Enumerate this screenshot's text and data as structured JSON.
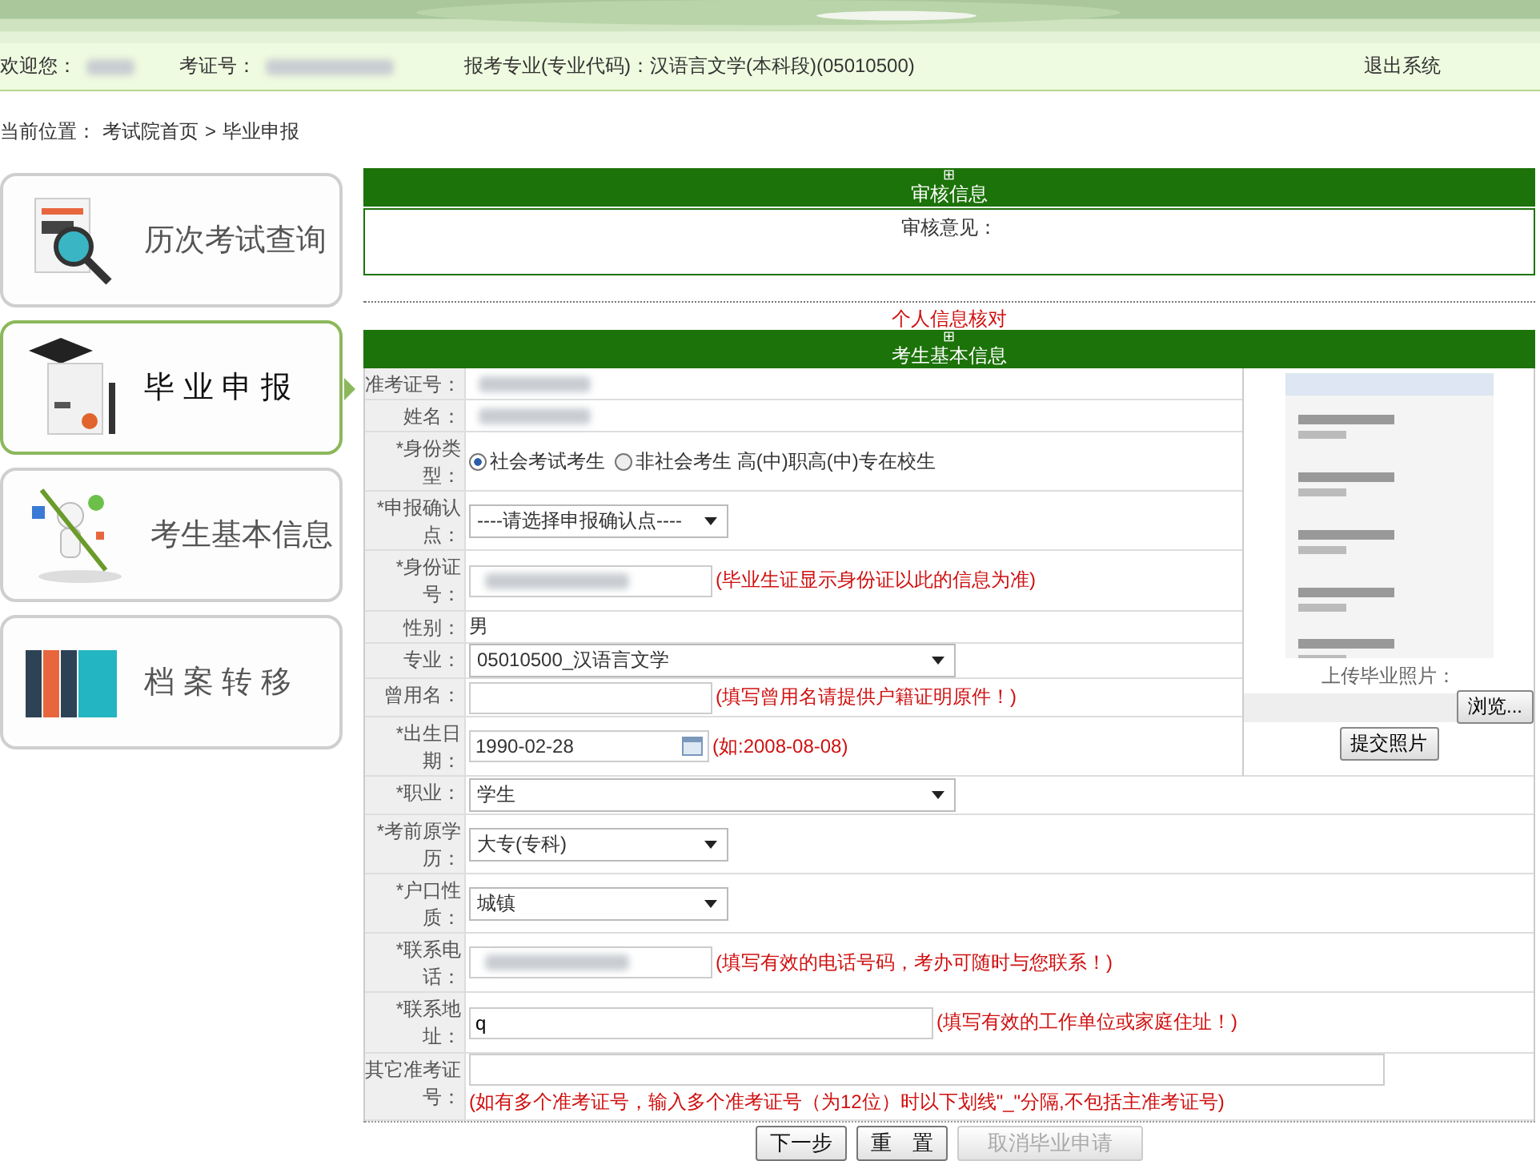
{
  "header": {
    "welcome_label": "欢迎您：",
    "exam_no_label": "考证号：",
    "major_label": "报考专业(专业代码)：汉语言文学(本科段)(05010500)",
    "logout": "退出系统"
  },
  "breadcrumb": {
    "prefix": "当前位置：",
    "home": "考试院首页",
    "separator": ">",
    "current": "毕业申报"
  },
  "sidebar": [
    {
      "label": "历次考试查询",
      "kind": "search",
      "selected": false
    },
    {
      "label": "毕 业 申 报",
      "kind": "diploma",
      "selected": true
    },
    {
      "label": "考生基本信息",
      "kind": "figure",
      "selected": false
    },
    {
      "label": "档 案 转 移",
      "kind": "folders",
      "selected": false
    }
  ],
  "audit": {
    "toggle": "⊞",
    "title": "审核信息",
    "opinion_label": "审核意见："
  },
  "section_title": "个人信息核对",
  "basic": {
    "toggle": "⊞",
    "title": "考生基本信息"
  },
  "photo": {
    "kind": "picture",
    "label": "上传毕业照片：",
    "browse": "浏览...",
    "submit": "提交照片"
  },
  "top_rows": [
    {
      "label": "准考证号：",
      "kind": "text",
      "redacted": true
    },
    {
      "label": "姓名：",
      "kind": "text",
      "redacted": true
    },
    {
      "label": "*身份类型：",
      "kind": "radio",
      "options": [
        {
          "label": "社会考试考生",
          "selected": true
        },
        {
          "label": "非社会考生 高(中)职高(中)专在校生",
          "selected": false
        }
      ]
    },
    {
      "label": "*申报确认点：",
      "kind": "select",
      "value": "----请选择申报确认点----"
    },
    {
      "label": "*身份证号：",
      "kind": "input",
      "redacted": true,
      "hint": "(毕业生证显示身份证以此的信息为准)"
    },
    {
      "label": "性别：",
      "kind": "text",
      "value": "男"
    },
    {
      "label": "专业：",
      "kind": "long_select",
      "value": "05010500_汉语言文学"
    },
    {
      "label": "曾用名：",
      "kind": "input",
      "hint": "(填写曾用名请提供户籍证明原件！)"
    },
    {
      "label": "*出生日期：",
      "kind": "date",
      "value": "1990-02-28",
      "hint": "(如:2008-08-08)"
    }
  ],
  "bottom_rows": [
    {
      "label": "*职业：",
      "kind": "long_select",
      "value": "学生"
    },
    {
      "label": "*考前原学历：",
      "kind": "select",
      "value": "大专(专科)"
    },
    {
      "label": "*户口性质：",
      "kind": "select",
      "value": "城镇"
    },
    {
      "label": "*联系电话：",
      "kind": "input",
      "redacted": true,
      "hint": "(填写有效的电话号码，考办可随时与您联系！)"
    },
    {
      "label": "*联系地址：",
      "kind": "long_input",
      "value": "q",
      "hint": "(填写有效的工作单位或家庭住址！)"
    },
    {
      "label": "其它准考证号：",
      "kind": "wide",
      "hint": "(如有多个准考证号，输入多个准考证号（为12位）时以下划线\"_\"分隔,不包括主准考证号)"
    }
  ],
  "buttons": [
    {
      "label": "下一步",
      "disabled": false
    },
    {
      "label": "重　置",
      "disabled": false
    },
    {
      "label": "取消毕业申请",
      "disabled": true
    }
  ]
}
